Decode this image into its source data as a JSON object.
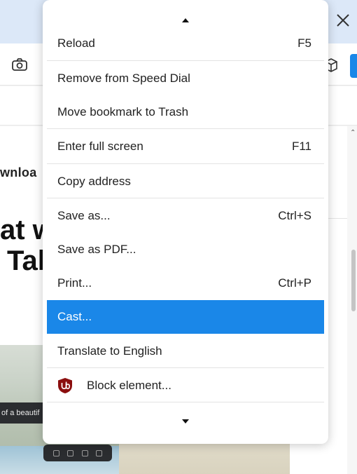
{
  "background": {
    "download_text": "wnloa",
    "headline_line1": "at w",
    "headline_line2": "Tal",
    "image_caption": "of a beautif"
  },
  "menu": {
    "items": [
      {
        "label": "Reload",
        "shortcut": "F5"
      },
      {
        "label": "Remove from Speed Dial",
        "shortcut": ""
      },
      {
        "label": "Move bookmark to Trash",
        "shortcut": ""
      },
      {
        "label": "Enter full screen",
        "shortcut": "F11"
      },
      {
        "label": "Copy address",
        "shortcut": ""
      },
      {
        "label": "Save as...",
        "shortcut": "Ctrl+S"
      },
      {
        "label": "Save as PDF...",
        "shortcut": ""
      },
      {
        "label": "Print...",
        "shortcut": "Ctrl+P"
      },
      {
        "label": "Cast...",
        "shortcut": "",
        "highlighted": true
      },
      {
        "label": "Translate to English",
        "shortcut": ""
      },
      {
        "label": "Block element...",
        "shortcut": "",
        "icon": "ublock-origin-icon"
      }
    ]
  },
  "colors": {
    "accent": "#1a87e8",
    "ublock_red": "#8b0e0e"
  }
}
